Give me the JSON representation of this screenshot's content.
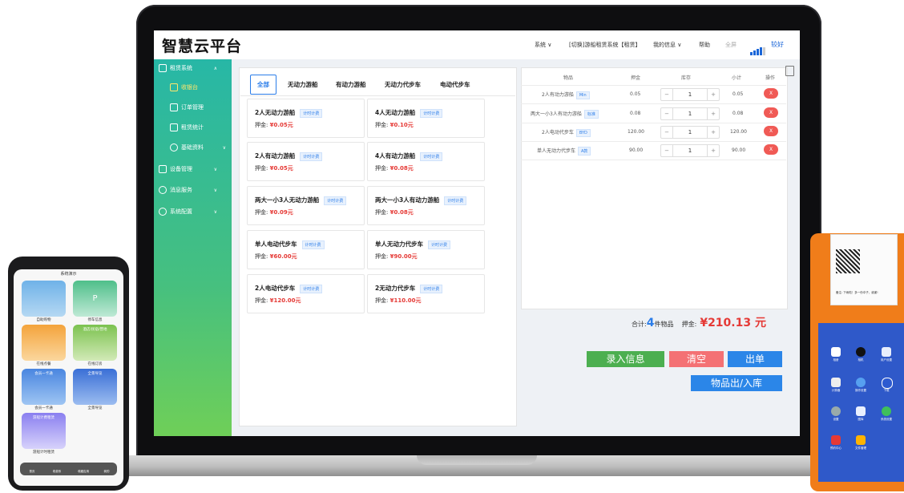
{
  "header": {
    "brand": "智慧云平台",
    "nav": [
      "系统 ∨",
      "[切换]游船租赁系统【租赁】",
      "我的信息 ∨",
      "帮助",
      "全屏"
    ],
    "signal_label": "较好",
    "accent": "#2b7de9"
  },
  "sidebar": {
    "items": [
      {
        "label": "租赁系统",
        "icon": "smile-icon",
        "sub": false
      },
      {
        "label": "收银台",
        "icon": "cashier-icon",
        "sub": true
      },
      {
        "label": "订单管理",
        "icon": "list-icon",
        "sub": true
      },
      {
        "label": "租赁统计",
        "icon": "chart-icon",
        "sub": true
      },
      {
        "label": "基础资料",
        "icon": "gear-icon",
        "sub": true
      },
      {
        "label": "设备管理",
        "icon": "monitor-icon",
        "sub": false
      },
      {
        "label": "消息服务",
        "icon": "chat-icon",
        "sub": false
      },
      {
        "label": "系统配置",
        "icon": "settings-icon",
        "sub": false
      }
    ]
  },
  "tabs": [
    "全部",
    "无动力游船",
    "有动力游船",
    "无动力代步车",
    "电动代步车"
  ],
  "products": [
    {
      "name": "2人无动力游船",
      "tag": "计时计费",
      "deposit_label": "押金:",
      "deposit": "¥0.05元"
    },
    {
      "name": "4人无动力游船",
      "tag": "计时计费",
      "deposit_label": "押金:",
      "deposit": "¥0.10元"
    },
    {
      "name": "2人有动力游船",
      "tag": "计时计费",
      "deposit_label": "押金:",
      "deposit": "¥0.05元"
    },
    {
      "name": "4人有动力游船",
      "tag": "计时计费",
      "deposit_label": "押金:",
      "deposit": "¥0.08元"
    },
    {
      "name": "两大一小3人无动力游船",
      "tag": "计时计费",
      "deposit_label": "押金:",
      "deposit": "¥0.09元"
    },
    {
      "name": "两大一小3人有动力游船",
      "tag": "计时计费",
      "deposit_label": "押金:",
      "deposit": "¥0.08元"
    },
    {
      "name": "单人电动代步车",
      "tag": "计时计费",
      "deposit_label": "押金:",
      "deposit": "¥60.00元"
    },
    {
      "name": "单人无动力代步车",
      "tag": "计时计费",
      "deposit_label": "押金:",
      "deposit": "¥90.00元"
    },
    {
      "name": "2人电动代步车",
      "tag": "计时计费",
      "deposit_label": "押金:",
      "deposit": "¥120.00元"
    },
    {
      "name": "2无动力代步车",
      "tag": "计时计费",
      "deposit_label": "押金:",
      "deposit": "¥110.00元"
    }
  ],
  "cart": {
    "headers": [
      "物品",
      "押金",
      "库存",
      "小计",
      "操作"
    ],
    "rows": [
      {
        "item": "2人有动力游船",
        "badge": "Min",
        "deposit": "0.05",
        "qty": "1",
        "subtotal": "0.05",
        "action": "X"
      },
      {
        "item": "两大一小3人有动力游船",
        "badge": "标准",
        "deposit": "0.08",
        "qty": "1",
        "subtotal": "0.08",
        "action": "X"
      },
      {
        "item": "2人电动代步车",
        "badge": "BYD",
        "deposit": "120.00",
        "qty": "1",
        "subtotal": "120.00",
        "action": "X"
      },
      {
        "item": "单人无动力代步车",
        "badge": "A款",
        "deposit": "90.00",
        "qty": "1",
        "subtotal": "90.00",
        "action": "X"
      }
    ],
    "minus": "−",
    "plus": "+"
  },
  "summary": {
    "total_prefix": "合计:",
    "count": "4",
    "count_suffix": "件物品",
    "deposit_label": "押金:",
    "deposit_total": "¥210.13 元"
  },
  "actions": {
    "enter_info": "录入信息",
    "clear": "清空",
    "checkout": "出单",
    "stock": "物品出/入库",
    "colors": {
      "enter": "#4caf50",
      "clear": "#f47174",
      "blue": "#2b86e8"
    }
  },
  "phone": {
    "title": "系统演示",
    "tiles": [
      {
        "label": "自助购物"
      },
      {
        "label": "停车信息",
        "overlay": "P"
      },
      {
        "label": "在线点餐"
      },
      {
        "label": "在线订房",
        "overlay": "酒店/民宿/营地"
      },
      {
        "label": "会员一卡通",
        "overlay": "会员一卡通"
      },
      {
        "label": "全景导览",
        "overlay": "全景导览"
      },
      {
        "label": "游船计时租赁",
        "overlay": "游船计费租赁"
      }
    ],
    "bottom_nav": [
      "首页",
      "收费系",
      "收藏应用",
      "我的"
    ]
  },
  "pos": {
    "receipt_note": "备注: 下雨啦！多一份伞子，谢谢!",
    "apps": [
      "相册",
      "相机",
      "用户设置",
      "计算器",
      "操作设置",
      "下载",
      "设置",
      "图库",
      "系统设置",
      "预约中心",
      "文件管理"
    ]
  }
}
